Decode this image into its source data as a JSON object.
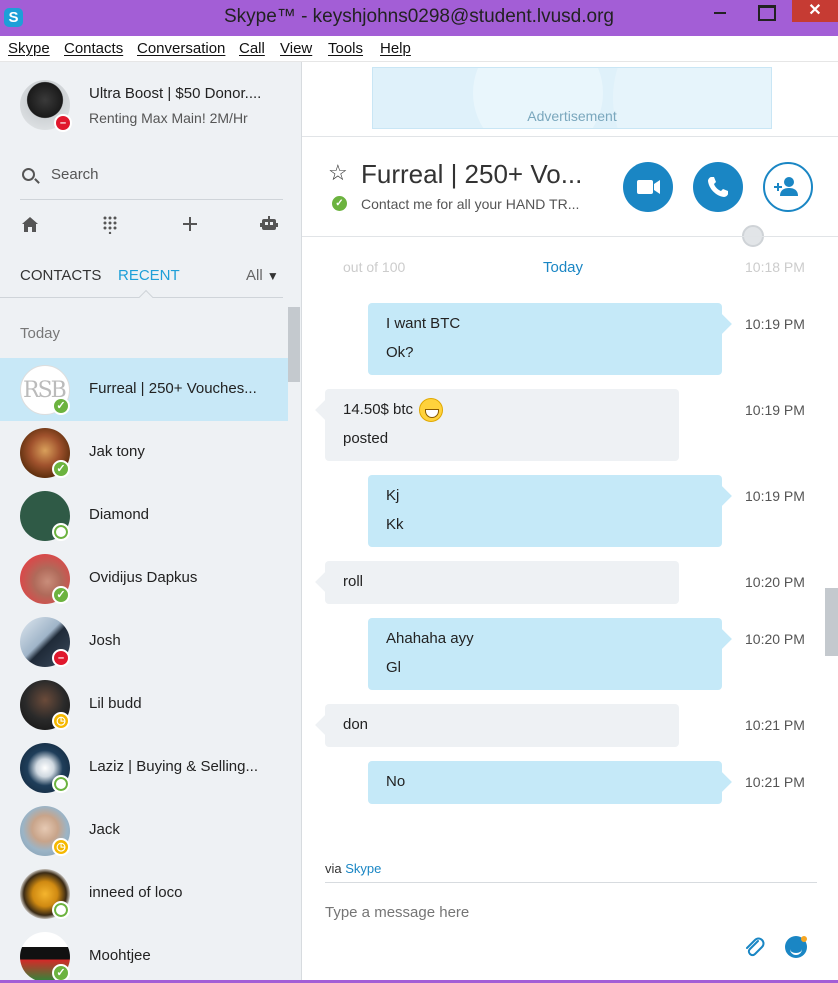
{
  "window": {
    "title": "Skype™ - keyshjohns0298@student.lvusd.org",
    "logo": "S",
    "close_label": "✕"
  },
  "menu": [
    "Skype",
    "Contacts",
    "Conversation",
    "Call",
    "View",
    "Tools",
    "Help"
  ],
  "profile": {
    "name": "Ultra Boost | $50 Donor....",
    "mood": "Renting Max Main! 2M/Hr",
    "status": "busy"
  },
  "search": {
    "label": "Search"
  },
  "tabs": {
    "contacts": "CONTACTS",
    "recent": "RECENT",
    "filter": "All"
  },
  "section": {
    "today": "Today"
  },
  "contacts": [
    {
      "name": "Furreal | 250+ Vouches...",
      "status": "online",
      "avatar_text": "RSB",
      "selected": true
    },
    {
      "name": "Jak tony",
      "status": "online"
    },
    {
      "name": "Diamond",
      "status": "offline"
    },
    {
      "name": "Ovidijus Dapkus",
      "status": "online"
    },
    {
      "name": "Josh",
      "status": "busy"
    },
    {
      "name": "Lil budd",
      "status": "away"
    },
    {
      "name": "Laziz | Buying & Selling...",
      "status": "offline"
    },
    {
      "name": "Jack",
      "status": "away"
    },
    {
      "name": "inneed of loco",
      "status": "offline"
    },
    {
      "name": "Moohtjee",
      "status": "online"
    }
  ],
  "ad": {
    "label": "Advertisement"
  },
  "conversation": {
    "title": "Furreal | 250+ Vo...",
    "mood": "Contact me for all your HAND TR...",
    "faded_left": "out of 100",
    "faded_time": "10:18 PM",
    "day_label": "Today",
    "messages": [
      {
        "from": "me",
        "lines": [
          "I want BTC",
          "Ok?"
        ],
        "time": "10:19 PM"
      },
      {
        "from": "them",
        "lines": [
          "14.50$ btc",
          "posted"
        ],
        "time": "10:19 PM",
        "emoji": "grin"
      },
      {
        "from": "me",
        "lines": [
          "Kj",
          "Kk"
        ],
        "time": "10:19 PM"
      },
      {
        "from": "them",
        "lines": [
          "roll"
        ],
        "time": "10:20 PM"
      },
      {
        "from": "me",
        "lines": [
          "Ahahaha ayy",
          "Gl"
        ],
        "time": "10:20 PM"
      },
      {
        "from": "them",
        "lines": [
          "don"
        ],
        "time": "10:21 PM"
      },
      {
        "from": "me",
        "lines": [
          "No"
        ],
        "time": "10:21 PM"
      }
    ]
  },
  "composer": {
    "via_prefix": "via",
    "via_link": "Skype",
    "placeholder": "Type a message here"
  },
  "colors": {
    "titlebar": "#a35ed6",
    "accent": "#1a86c4",
    "online": "#6cb33f",
    "busy": "#e0182d",
    "away": "#f5b800"
  }
}
